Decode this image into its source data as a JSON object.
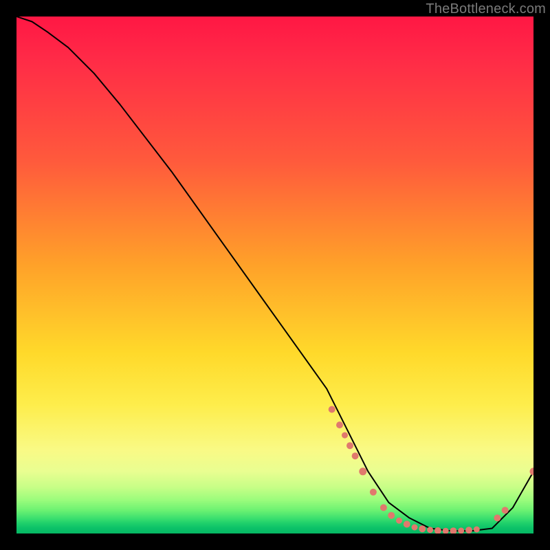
{
  "watermark": "TheBottleneck.com",
  "colors": {
    "dot": "#e0796d",
    "line": "#000000",
    "frame": "#000000"
  },
  "chart_data": {
    "type": "line",
    "title": "",
    "xlabel": "",
    "ylabel": "",
    "xlim": [
      0,
      100
    ],
    "ylim": [
      0,
      100
    ],
    "grid": false,
    "legend": false,
    "notes": "Monotone curve descending from top-left to a flat minimum near x≈70–90 then rising at the right edge. Salmon dots mark highlighted sample points on the descending slope, the flat valley, and the final rise.",
    "series": [
      {
        "name": "curve",
        "x": [
          0,
          3,
          6,
          10,
          15,
          20,
          30,
          40,
          50,
          60,
          64,
          68,
          72,
          76,
          80,
          84,
          88,
          92,
          96,
          100
        ],
        "y": [
          100,
          99,
          97,
          94,
          89,
          83,
          70,
          56,
          42,
          28,
          20,
          12,
          6,
          3,
          1,
          0.5,
          0.5,
          1,
          5,
          12
        ]
      }
    ],
    "highlight_points": {
      "name": "dots",
      "x": [
        61,
        62.5,
        63.5,
        64.5,
        65.5,
        67,
        69,
        71,
        72.5,
        74,
        75.5,
        77,
        78.5,
        80,
        81.5,
        83,
        84.5,
        86,
        87.5,
        89,
        93,
        94.5,
        100
      ],
      "y": [
        24,
        21,
        19,
        17,
        15,
        12,
        8,
        5,
        3.5,
        2.5,
        1.8,
        1.2,
        0.9,
        0.7,
        0.55,
        0.5,
        0.5,
        0.55,
        0.65,
        0.8,
        3,
        4.5,
        12
      ],
      "r": [
        5,
        5,
        4.5,
        5,
        5,
        5.5,
        5,
        5,
        5,
        4.5,
        5,
        4.5,
        5,
        4.5,
        5,
        4.5,
        5,
        4.5,
        5,
        4.5,
        5,
        5,
        5.5
      ]
    }
  }
}
